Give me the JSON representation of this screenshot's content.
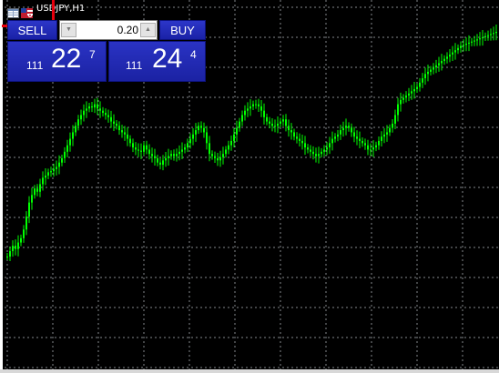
{
  "window": {
    "title": "USDJPY,H1"
  },
  "icons": {
    "chart_table": "table-icon",
    "symbol_flag": "flag-icon"
  },
  "colors": {
    "background": "#000000",
    "grid": "#9aa0a6",
    "candle_up": "#00ff00",
    "trade_button": "#1f28b4",
    "highlight": "#e8000d"
  },
  "trade_panel": {
    "sell_label": "SELL",
    "buy_label": "BUY",
    "lot_value": "0.20",
    "bid": {
      "prefix": "111",
      "big": "22",
      "superscript": "7"
    },
    "ask": {
      "prefix": "111",
      "big": "24",
      "superscript": "4"
    }
  },
  "chart_data": {
    "type": "line",
    "symbol": "USDJPY",
    "timeframe": "H1",
    "grid": true,
    "x": [
      1,
      2,
      3,
      4,
      5,
      6,
      7,
      8,
      9,
      10,
      11,
      12,
      13,
      14,
      15,
      16,
      17,
      18,
      19,
      20,
      21,
      22,
      23,
      24,
      25,
      26,
      27,
      28,
      29,
      30,
      31,
      32,
      33,
      34,
      35,
      36,
      37,
      38,
      39,
      40,
      41,
      42,
      43,
      44,
      45,
      46,
      47,
      48,
      49,
      50,
      51,
      52,
      53,
      54,
      55,
      56,
      57,
      58,
      59,
      60,
      61,
      62,
      63,
      64,
      65,
      66,
      67,
      68,
      69,
      70,
      71,
      72,
      73,
      74,
      75,
      76,
      77,
      78,
      79,
      80,
      81,
      82,
      83,
      84,
      85,
      86,
      87,
      88,
      89,
      90,
      91,
      92,
      93,
      94,
      95,
      96,
      97,
      98,
      99,
      100,
      101,
      102,
      103,
      104,
      105,
      106,
      107,
      108,
      109,
      110,
      111,
      112,
      113,
      114,
      115,
      116,
      117,
      118,
      119,
      120,
      121,
      122,
      123,
      124,
      125,
      126,
      127,
      128,
      129,
      130,
      131,
      132,
      133,
      134,
      135,
      136,
      137,
      138,
      139,
      140,
      141,
      142,
      143,
      144,
      145,
      146,
      147,
      148,
      149,
      150,
      151,
      152,
      153,
      154,
      155,
      156,
      157,
      158,
      159,
      160,
      161,
      162,
      163,
      164,
      165,
      166,
      167,
      168,
      169,
      170,
      171,
      172,
      173,
      174,
      175,
      176,
      177,
      178,
      179,
      180
    ],
    "series": [
      {
        "values": [
          5,
          10,
          15,
          12,
          18,
          22,
          30,
          42,
          55,
          62,
          68,
          65,
          72,
          78,
          80,
          83,
          84,
          86,
          88,
          92,
          96,
          102,
          108,
          114,
          120,
          126,
          132,
          136,
          140,
          142,
          144,
          143,
          146,
          142,
          140,
          138,
          136,
          134,
          130,
          128,
          126,
          122,
          120,
          118,
          114,
          110,
          106,
          104,
          103,
          102,
          108,
          104,
          100,
          98,
          96,
          92,
          90,
          94,
          96,
          98,
          100,
          98,
          100,
          102,
          104,
          106,
          110,
          114,
          118,
          122,
          126,
          124,
          120,
          110,
          100,
          98,
          96,
          94,
          97,
          100,
          104,
          108,
          112,
          118,
          124,
          130,
          136,
          140,
          142,
          144,
          146,
          146,
          144,
          140,
          134,
          130,
          128,
          126,
          126,
          128,
          130,
          132,
          126,
          122,
          120,
          116,
          114,
          112,
          110,
          106,
          104,
          102,
          100,
          98,
          100,
          102,
          104,
          106,
          110,
          114,
          116,
          118,
          122,
          124,
          126,
          124,
          120,
          116,
          114,
          112,
          110,
          108,
          104,
          104,
          106,
          108,
          112,
          116,
          118,
          120,
          124,
          128,
          136,
          146,
          150,
          152,
          154,
          156,
          158,
          160,
          162,
          166,
          170,
          174,
          176,
          178,
          180,
          182,
          184,
          186,
          188,
          190,
          192,
          194,
          196,
          198,
          200,
          201,
          202,
          203,
          204,
          205,
          206,
          207,
          208,
          209,
          210,
          211,
          212,
          213
        ]
      }
    ]
  }
}
